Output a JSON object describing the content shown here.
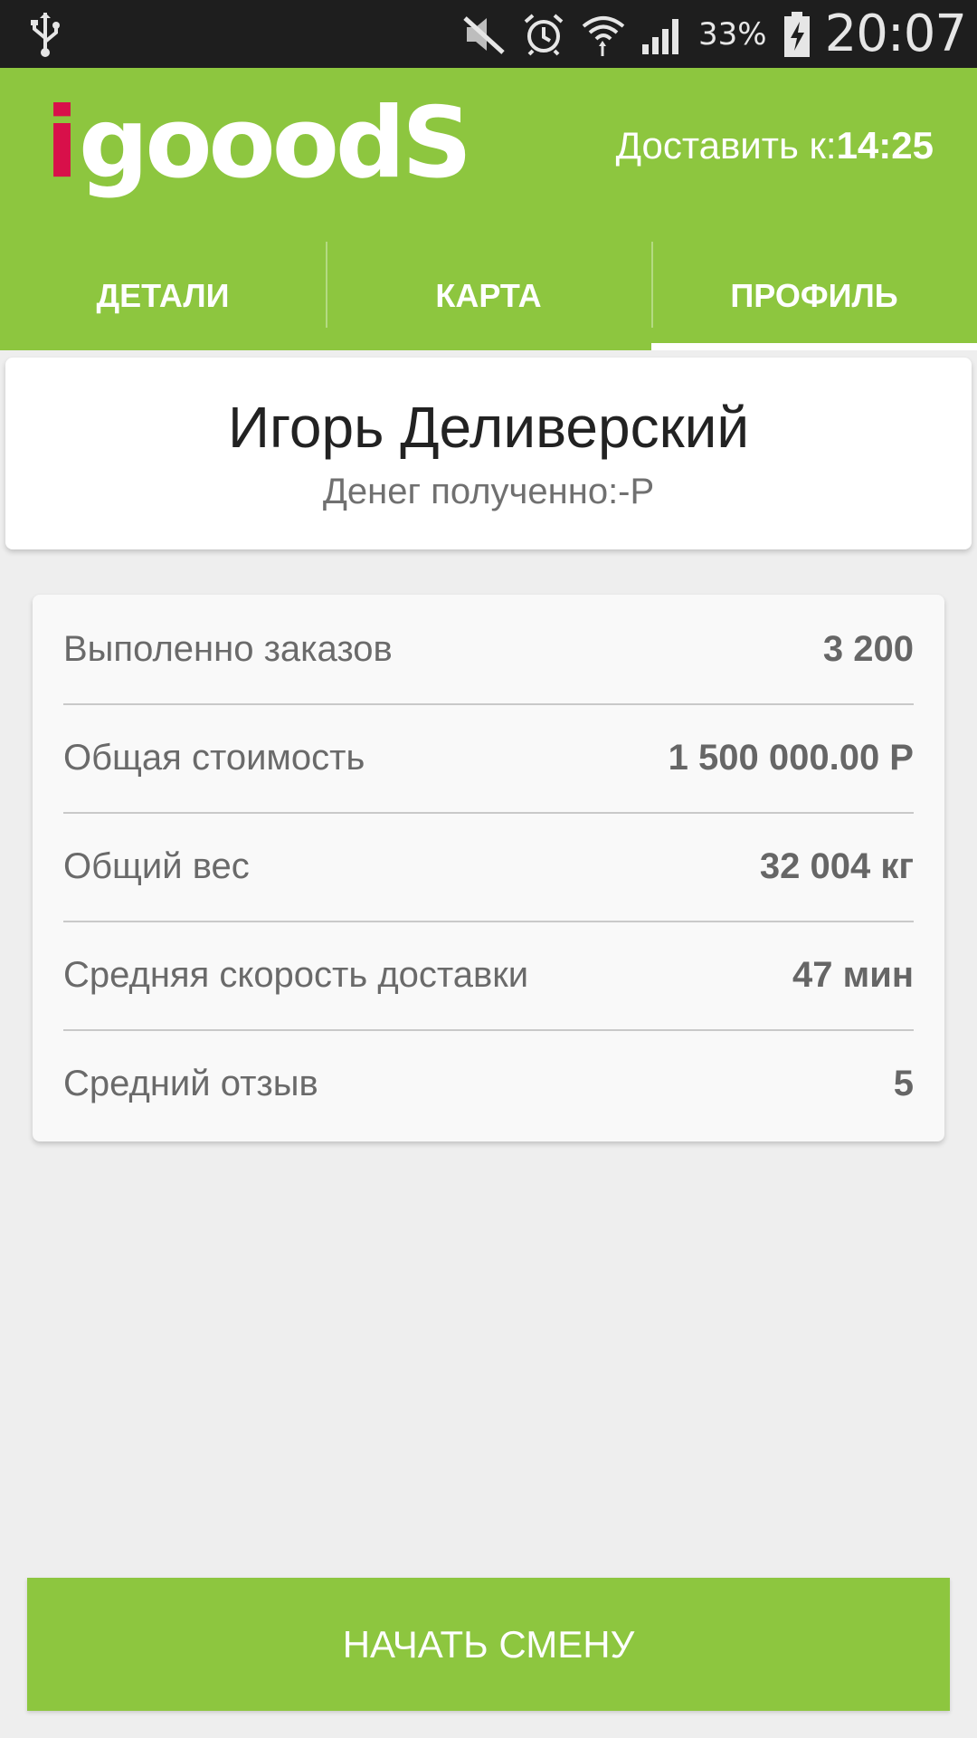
{
  "status_bar": {
    "battery_percent": "33%",
    "time": "20:07",
    "icons": [
      "usb-icon",
      "mute-icon",
      "alarm-icon",
      "wifi-icon",
      "signal-icon",
      "battery-charging-icon"
    ]
  },
  "app_bar": {
    "logo_text_i": "i",
    "logo_text_rest": "gooodS",
    "deliver_label": "Доставить к:",
    "deliver_time": "14:25",
    "brand_color": "#8dc63f",
    "logo_accent_color": "#d8104a"
  },
  "tabs": [
    {
      "label": "ДЕТАЛИ",
      "active": false
    },
    {
      "label": "КАРТА",
      "active": false
    },
    {
      "label": "ПРОФИЛЬ",
      "active": true
    }
  ],
  "profile": {
    "name": "Игорь Деливерский",
    "money_received": "Денег полученно:-Р"
  },
  "stats": [
    {
      "label": "Выполенно заказов",
      "value": "3 200"
    },
    {
      "label": "Общая стоимость",
      "value": "1 500 000.00 Р"
    },
    {
      "label": "Общий вес",
      "value": "32 004 кг"
    },
    {
      "label": "Средняя скорость доставки",
      "value": "47 мин"
    },
    {
      "label": "Средний отзыв",
      "value": "5"
    }
  ],
  "start_shift_button": "НАЧАТЬ СМЕНУ"
}
